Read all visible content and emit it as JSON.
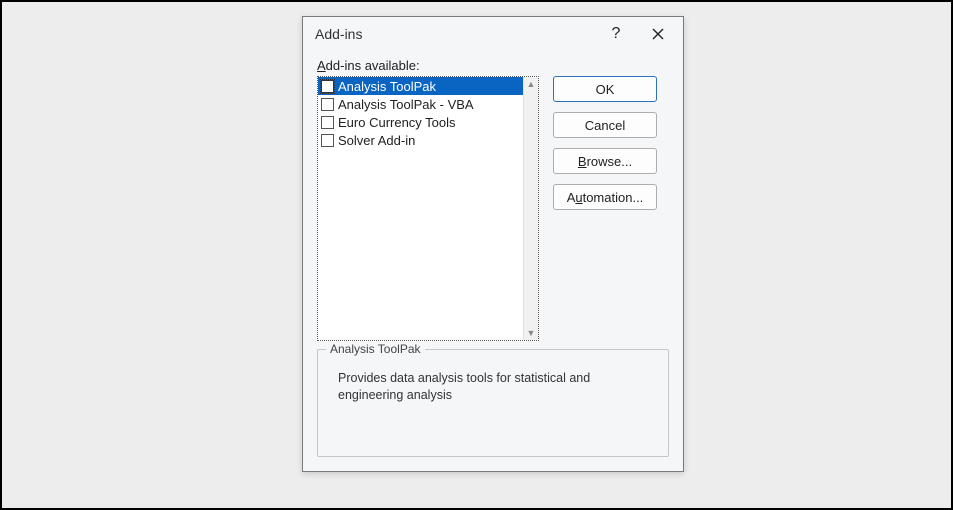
{
  "dialog": {
    "title": "Add-ins",
    "available_label": "Add-ins available:",
    "items": [
      {
        "label": "Analysis ToolPak",
        "checked": false,
        "selected": true
      },
      {
        "label": "Analysis ToolPak - VBA",
        "checked": false,
        "selected": false
      },
      {
        "label": "Euro Currency Tools",
        "checked": false,
        "selected": false
      },
      {
        "label": "Solver Add-in",
        "checked": false,
        "selected": false
      }
    ],
    "buttons": {
      "ok": "OK",
      "cancel": "Cancel",
      "browse": "Browse...",
      "automation": "Automation..."
    },
    "description": {
      "legend": "Analysis ToolPak",
      "text": "Provides data analysis tools for statistical and engineering analysis"
    }
  }
}
